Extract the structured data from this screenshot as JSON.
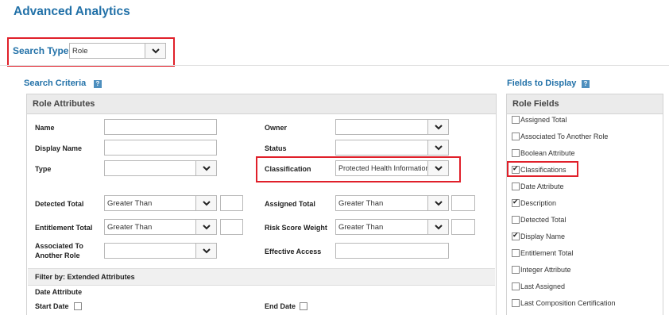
{
  "page_title": "Advanced Analytics",
  "search_type": {
    "label": "Search Type",
    "value": "Role"
  },
  "search_criteria": {
    "title": "Search Criteria",
    "help": "?",
    "panel_title": "Role Attributes",
    "name_label": "Name",
    "display_name_label": "Display Name",
    "type_label": "Type",
    "owner_label": "Owner",
    "status_label": "Status",
    "classification_label": "Classification",
    "classification_value": "Protected Health Information",
    "detected_total_label": "Detected Total",
    "detected_total_op": "Greater Than",
    "assigned_total_label": "Assigned Total",
    "assigned_total_op": "Greater Than",
    "entitlement_total_label": "Entitlement Total",
    "entitlement_total_op": "Greater Than",
    "risk_score_weight_label": "Risk Score Weight",
    "risk_score_weight_op": "Greater Than",
    "associated_label_1": "Associated To",
    "associated_label_2": "Another Role",
    "effective_access_label": "Effective Access",
    "filter_title": "Filter by: Extended Attributes",
    "date_attribute_label": "Date Attribute",
    "start_date_label": "Start Date",
    "end_date_label": "End Date"
  },
  "fields_to_display": {
    "title": "Fields to Display",
    "help": "?",
    "panel_title": "Role Fields",
    "items": [
      {
        "label": "Assigned Total",
        "checked": false
      },
      {
        "label": "Associated To Another Role",
        "checked": false
      },
      {
        "label": "Boolean Attribute",
        "checked": false
      },
      {
        "label": "Classifications",
        "checked": true
      },
      {
        "label": "Date Attribute",
        "checked": false
      },
      {
        "label": "Description",
        "checked": true
      },
      {
        "label": "Detected Total",
        "checked": false
      },
      {
        "label": "Display Name",
        "checked": true
      },
      {
        "label": "Entitlement Total",
        "checked": false
      },
      {
        "label": "Integer Attribute",
        "checked": false
      },
      {
        "label": "Last Assigned",
        "checked": false
      },
      {
        "label": "Last Composition Certification",
        "checked": false
      }
    ]
  }
}
